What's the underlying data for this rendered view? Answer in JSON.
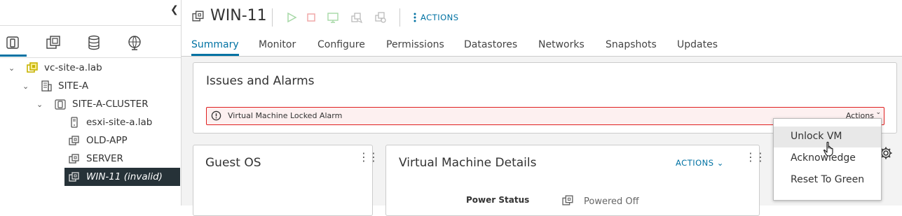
{
  "sidebar": {
    "tree": [
      {
        "label": "vc-site-a.lab",
        "icon": "vcenter-icon"
      },
      {
        "label": "SITE-A",
        "icon": "datacenter-icon"
      },
      {
        "label": "SITE-A-CLUSTER",
        "icon": "cluster-icon"
      },
      {
        "label": "esxi-site-a.lab",
        "icon": "host-icon"
      },
      {
        "label": "OLD-APP",
        "icon": "vm-icon"
      },
      {
        "label": "SERVER",
        "icon": "vm-icon"
      },
      {
        "label": "WIN-11 (invalid)",
        "icon": "vm-icon",
        "selected": true
      }
    ]
  },
  "header": {
    "vm_name": "WIN-11",
    "actions_label": "ACTIONS"
  },
  "tabs": [
    "Summary",
    "Monitor",
    "Configure",
    "Permissions",
    "Datastores",
    "Networks",
    "Snapshots",
    "Updates"
  ],
  "issues": {
    "title": "Issues and Alarms",
    "alarm_text": "Virtual Machine Locked Alarm",
    "alarm_actions": "Actions"
  },
  "guest_os": {
    "title": "Guest OS"
  },
  "vm_details": {
    "title": "Virtual Machine Details",
    "actions_label": "ACTIONS",
    "power_status_label": "Power Status",
    "power_status_value": "Powered Off"
  },
  "context_menu": {
    "items": [
      "Unlock VM",
      "Acknowledge",
      "Reset To Green"
    ]
  },
  "colors": {
    "accent": "#0072a3",
    "alarm_border": "#e02020",
    "selected_row": "#263238",
    "vcenter_icon": "#c8b400"
  }
}
